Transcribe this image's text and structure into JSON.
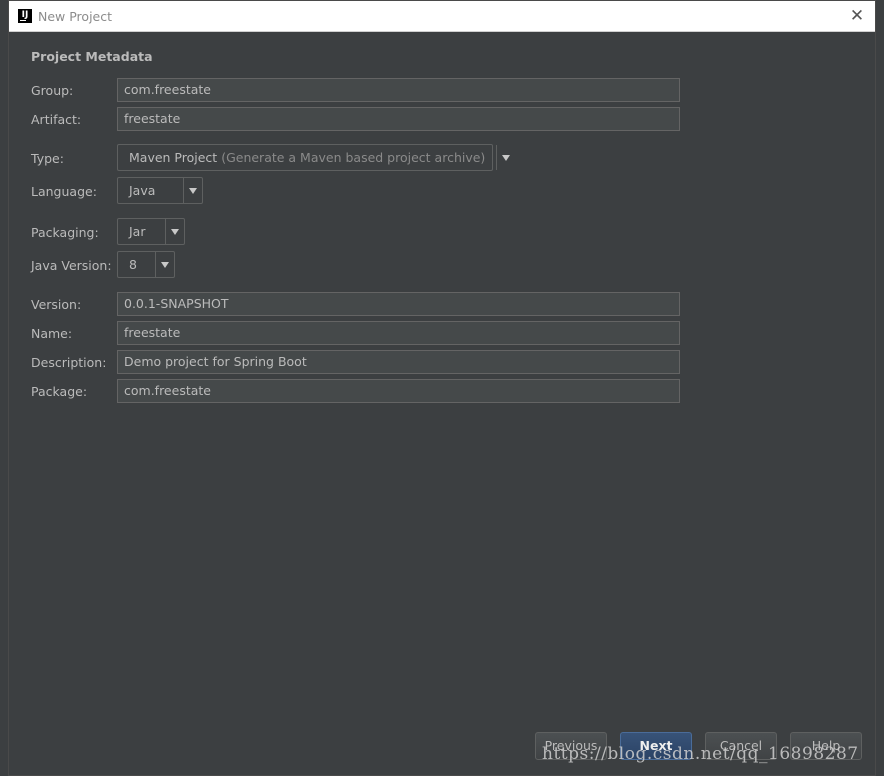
{
  "window": {
    "title": "New Project"
  },
  "section": {
    "title": "Project Metadata"
  },
  "fields": {
    "group": {
      "label": "Group:",
      "value": "com.freestate"
    },
    "artifact": {
      "label": "Artifact:",
      "value": "freestate"
    },
    "type": {
      "label": "Type:",
      "value": "Maven Project",
      "hint": "(Generate a Maven based project archive)"
    },
    "language": {
      "label": "Language:",
      "value": "Java"
    },
    "packaging": {
      "label": "Packaging:",
      "value": "Jar"
    },
    "java_version": {
      "label": "Java Version:",
      "value": "8"
    },
    "version": {
      "label": "Version:",
      "value": "0.0.1-SNAPSHOT"
    },
    "name": {
      "label": "Name:",
      "value": "freestate"
    },
    "description": {
      "label": "Description:",
      "value": "Demo project for Spring Boot"
    },
    "package": {
      "label": "Package:",
      "value": "com.freestate"
    }
  },
  "buttons": {
    "previous": "Previous",
    "next": "Next",
    "cancel": "Cancel",
    "help": "Help"
  },
  "watermark": "https://blog.csdn.net/qq_16898287",
  "colors": {
    "dialog_bg": "#3c3f41",
    "field_bg": "#45494a",
    "text": "#bbbbbb",
    "primary_button": "#385378"
  }
}
